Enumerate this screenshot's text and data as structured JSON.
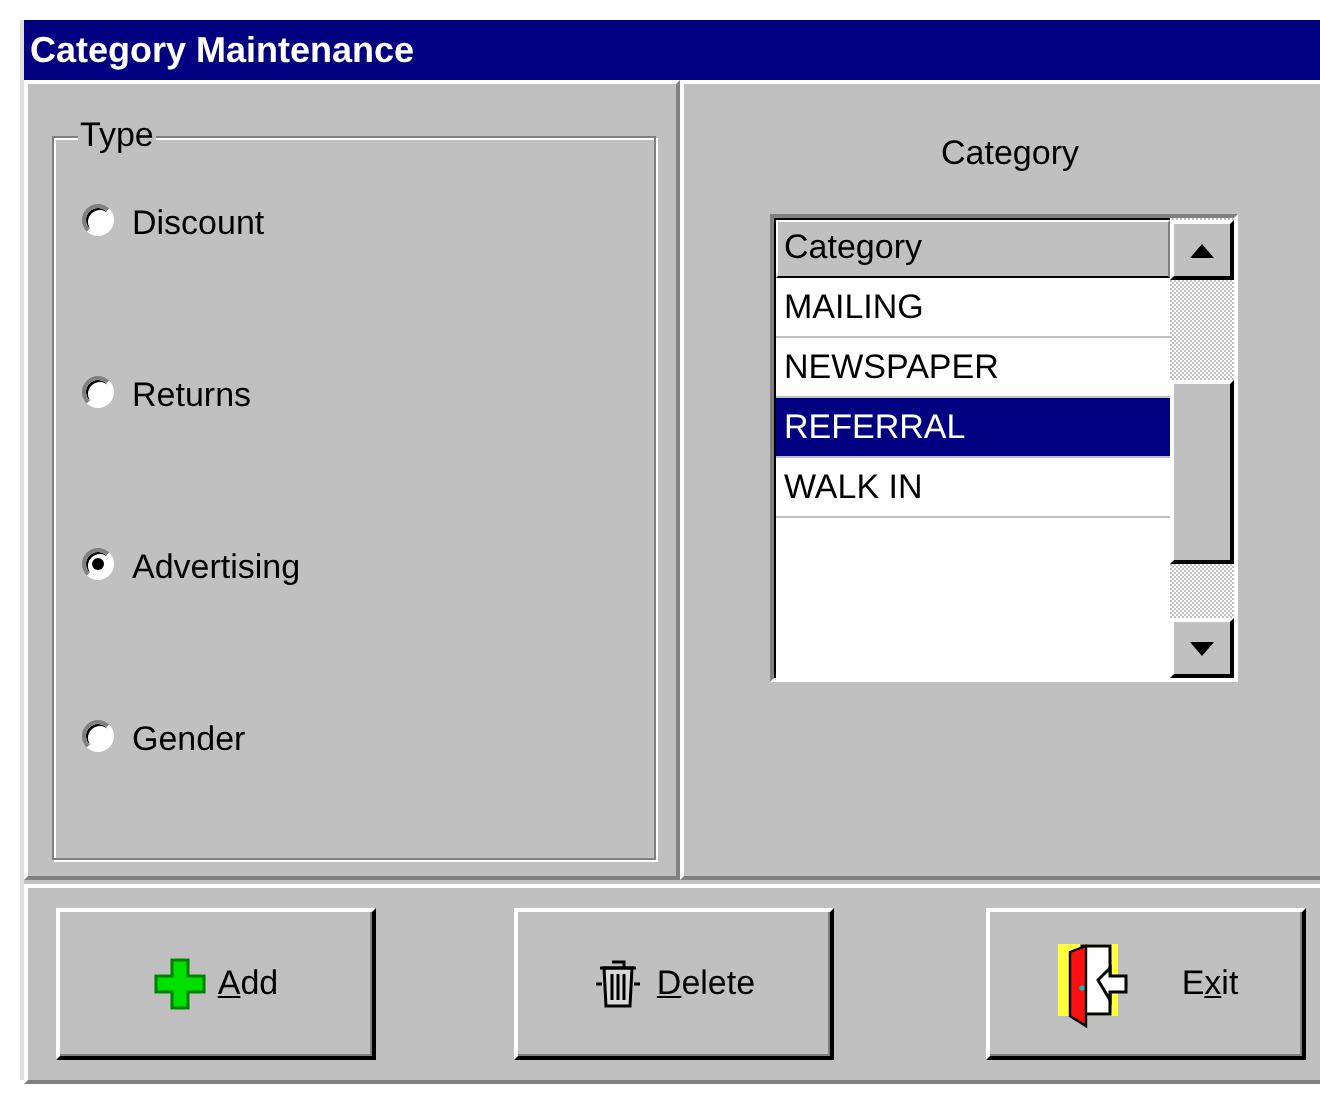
{
  "window": {
    "title": "Category Maintenance"
  },
  "type_group": {
    "legend": "Type",
    "options": [
      {
        "label": "Discount",
        "selected": false
      },
      {
        "label": "Returns",
        "selected": false
      },
      {
        "label": "Advertising",
        "selected": true
      },
      {
        "label": "Gender",
        "selected": false
      }
    ]
  },
  "category_panel": {
    "heading": "Category",
    "grid": {
      "column": "Category",
      "rows": [
        {
          "text": "MAILING",
          "selected": false
        },
        {
          "text": "NEWSPAPER",
          "selected": false
        },
        {
          "text": "REFERRAL",
          "selected": true
        },
        {
          "text": "WALK IN",
          "selected": false
        }
      ]
    }
  },
  "buttons": [
    {
      "kind": "add",
      "label_parts": [
        {
          "text": "A",
          "underlined": true
        },
        {
          "text": "dd",
          "underlined": false
        }
      ]
    },
    {
      "kind": "delete",
      "label_parts": [
        {
          "text": "D",
          "underlined": true
        },
        {
          "text": "elete",
          "underlined": false
        }
      ]
    },
    {
      "kind": "exit",
      "label_parts": [
        {
          "text": "E",
          "underlined": false
        },
        {
          "text": "x",
          "underlined": true
        },
        {
          "text": "it",
          "underlined": false
        }
      ]
    }
  ]
}
